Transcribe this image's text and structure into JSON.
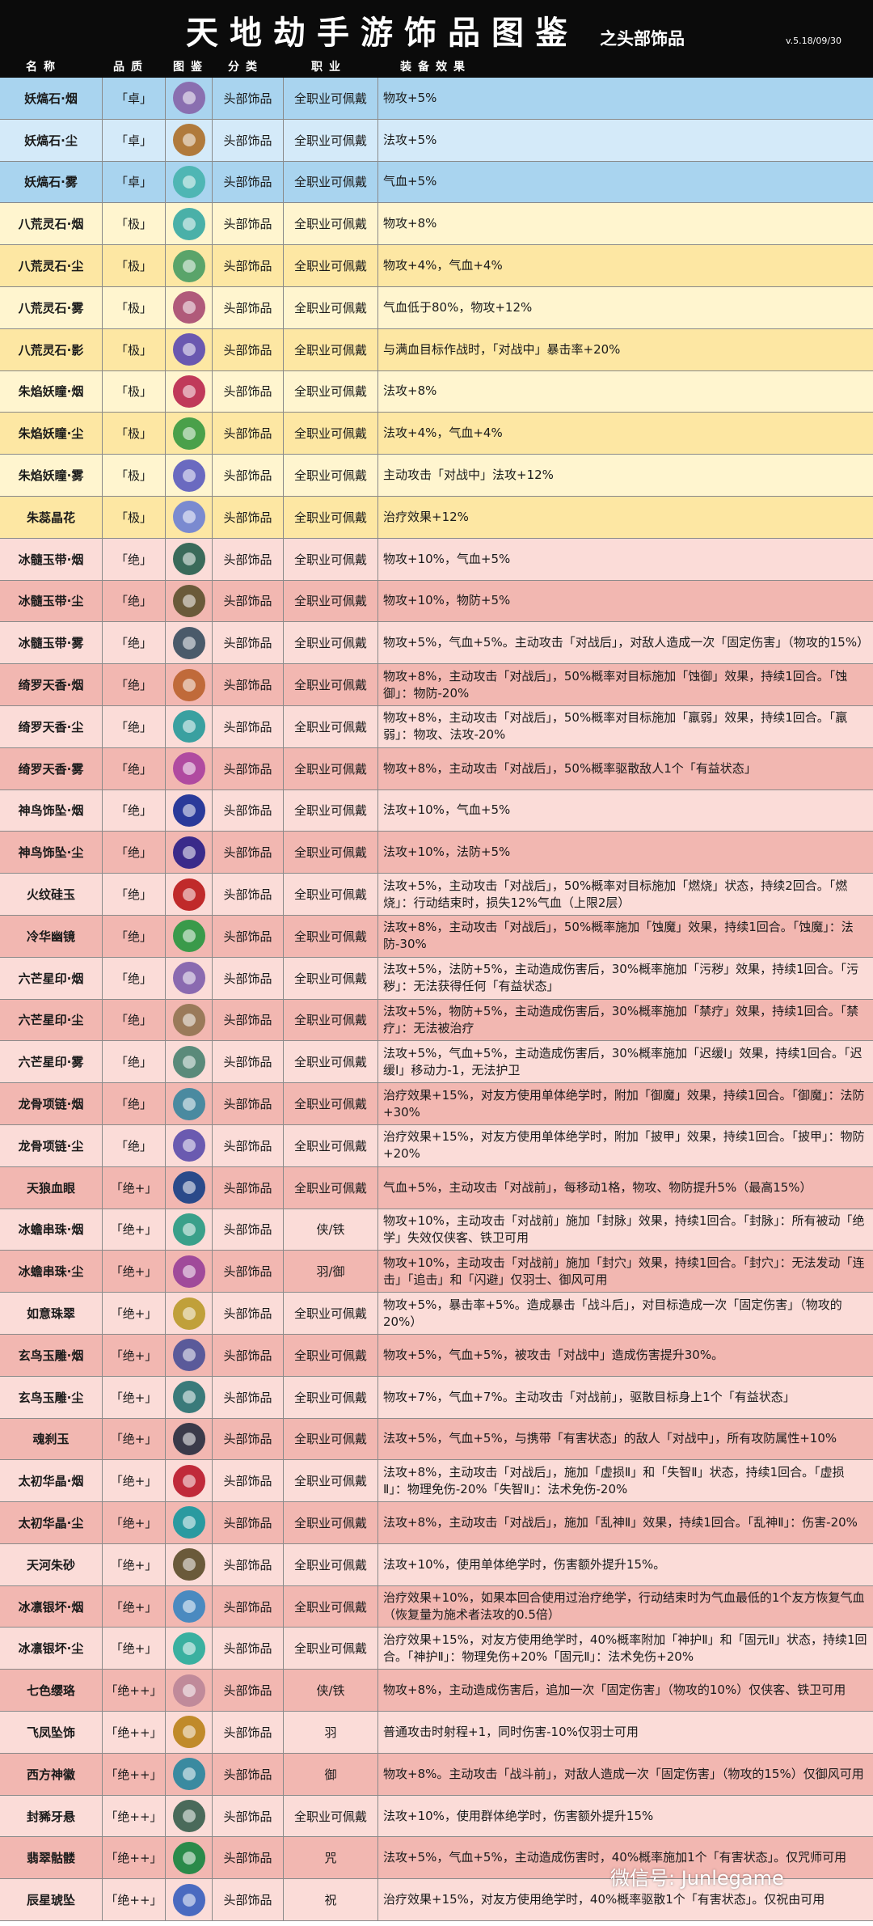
{
  "header": {
    "title": "天地劫手游饰品图鉴",
    "subtitle": "之头部饰品",
    "version": "v.5.18/09/30"
  },
  "columns": [
    "名称",
    "品质",
    "图鉴",
    "分类",
    "职业",
    "装备效果"
  ],
  "rows": [
    {
      "name": "妖熇石·烟",
      "quality": "「卓」",
      "icon": "pendant-icon",
      "icon_color": "#8a6fb0",
      "slot": "头部饰品",
      "job": "全职业可佩戴",
      "effect": "物攻+5%"
    },
    {
      "name": "妖熇石·尘",
      "quality": "「卓」",
      "icon": "pendant-icon",
      "icon_color": "#b07a3c",
      "slot": "头部饰品",
      "job": "全职业可佩戴",
      "effect": "法攻+5%"
    },
    {
      "name": "妖熇石·雾",
      "quality": "「卓」",
      "icon": "pendant-icon",
      "icon_color": "#4fb6b4",
      "slot": "头部饰品",
      "job": "全职业可佩戴",
      "effect": "气血+5%"
    },
    {
      "name": "八荒灵石·烟",
      "quality": "「极」",
      "icon": "crystal-icon",
      "icon_color": "#4ab0a8",
      "slot": "头部饰品",
      "job": "全职业可佩戴",
      "effect": "物攻+8%"
    },
    {
      "name": "八荒灵石·尘",
      "quality": "「极」",
      "icon": "crystal-icon",
      "icon_color": "#5aa46a",
      "slot": "头部饰品",
      "job": "全职业可佩戴",
      "effect": "物攻+4%，气血+4%"
    },
    {
      "name": "八荒灵石·雾",
      "quality": "「极」",
      "icon": "crystal-icon",
      "icon_color": "#b05a7a",
      "slot": "头部饰品",
      "job": "全职业可佩戴",
      "effect": "气血低于80%，物攻+12%"
    },
    {
      "name": "八荒灵石·影",
      "quality": "「极」",
      "icon": "crystal-icon",
      "icon_color": "#6a58b0",
      "slot": "头部饰品",
      "job": "全职业可佩戴",
      "effect": "与满血目标作战时，「对战中」暴击率+20%"
    },
    {
      "name": "朱焰妖瞳·烟",
      "quality": "「极」",
      "icon": "ring-icon",
      "icon_color": "#c03a5a",
      "slot": "头部饰品",
      "job": "全职业可佩戴",
      "effect": "法攻+8%"
    },
    {
      "name": "朱焰妖瞳·尘",
      "quality": "「极」",
      "icon": "ring-icon",
      "icon_color": "#4aa04a",
      "slot": "头部饰品",
      "job": "全职业可佩戴",
      "effect": "法攻+4%，气血+4%"
    },
    {
      "name": "朱焰妖瞳·雾",
      "quality": "「极」",
      "icon": "ring-icon",
      "icon_color": "#6a6ac0",
      "slot": "头部饰品",
      "job": "全职业可佩戴",
      "effect": "主动攻击「对战中」法攻+12%"
    },
    {
      "name": "朱蕊晶花",
      "quality": "「极」",
      "icon": "flower-icon",
      "icon_color": "#7a8ad0",
      "slot": "头部饰品",
      "job": "全职业可佩戴",
      "effect": "治疗效果+12%"
    },
    {
      "name": "冰髓玉带·烟",
      "quality": "「绝」",
      "icon": "belt-icon",
      "icon_color": "#3a6a5a",
      "slot": "头部饰品",
      "job": "全职业可佩戴",
      "effect": "物攻+10%，气血+5%"
    },
    {
      "name": "冰髓玉带·尘",
      "quality": "「绝」",
      "icon": "belt-icon",
      "icon_color": "#6a5a3a",
      "slot": "头部饰品",
      "job": "全职业可佩戴",
      "effect": "物攻+10%，物防+5%"
    },
    {
      "name": "冰髓玉带·雾",
      "quality": "「绝」",
      "icon": "belt-icon",
      "icon_color": "#4a5a6a",
      "slot": "头部饰品",
      "job": "全职业可佩戴",
      "effect": "物攻+5%，气血+5%。主动攻击「对战后」，对敌人造成一次「固定伤害」（物攻的15%）"
    },
    {
      "name": "绮罗天香·烟",
      "quality": "「绝」",
      "icon": "necklace-icon",
      "icon_color": "#c06a3a",
      "slot": "头部饰品",
      "job": "全职业可佩戴",
      "effect": "物攻+8%，主动攻击「对战后」，50%概率对目标施加「蚀御」效果，持续1回合。「蚀御」：物防-20%"
    },
    {
      "name": "绮罗天香·尘",
      "quality": "「绝」",
      "icon": "necklace-icon",
      "icon_color": "#3aa0a0",
      "slot": "头部饰品",
      "job": "全职业可佩戴",
      "effect": "物攻+8%，主动攻击「对战后」，50%概率对目标施加「羸弱」效果，持续1回合。「羸弱」：物攻、法攻-20%"
    },
    {
      "name": "绮罗天香·雾",
      "quality": "「绝」",
      "icon": "necklace-icon",
      "icon_color": "#b04aa0",
      "slot": "头部饰品",
      "job": "全职业可佩戴",
      "effect": "物攻+8%，主动攻击「对战后」，50%概率驱散敌人1个「有益状态」"
    },
    {
      "name": "神鸟饰坠·烟",
      "quality": "「绝」",
      "icon": "orb-icon",
      "icon_color": "#2a3a9a",
      "slot": "头部饰品",
      "job": "全职业可佩戴",
      "effect": "法攻+10%，气血+5%"
    },
    {
      "name": "神鸟饰坠·尘",
      "quality": "「绝」",
      "icon": "orb-icon",
      "icon_color": "#3a2a8a",
      "slot": "头部饰品",
      "job": "全职业可佩戴",
      "effect": "法攻+10%，法防+5%"
    },
    {
      "name": "火纹硅玉",
      "quality": "「绝」",
      "icon": "jade-icon",
      "icon_color": "#c02a2a",
      "slot": "头部饰品",
      "job": "全职业可佩戴",
      "effect": "法攻+5%，主动攻击「对战后」，50%概率对目标施加「燃烧」状态，持续2回合。「燃烧」：行动结束时，损失12%气血（上限2层）"
    },
    {
      "name": "冷华幽镜",
      "quality": "「绝」",
      "icon": "mirror-icon",
      "icon_color": "#3a9a4a",
      "slot": "头部饰品",
      "job": "全职业可佩戴",
      "effect": "法攻+8%，主动攻击「对战后」，50%概率施加「蚀魔」效果，持续1回合。「蚀魔」：法防-30%"
    },
    {
      "name": "六芒星印·烟",
      "quality": "「绝」",
      "icon": "seal-icon",
      "icon_color": "#8a6ab0",
      "slot": "头部饰品",
      "job": "全职业可佩戴",
      "effect": "法攻+5%，法防+5%，主动造成伤害后，30%概率施加「污秽」效果，持续1回合。「污秽」：无法获得任何「有益状态」"
    },
    {
      "name": "六芒星印·尘",
      "quality": "「绝」",
      "icon": "seal-icon",
      "icon_color": "#9a7a5a",
      "slot": "头部饰品",
      "job": "全职业可佩戴",
      "effect": "法攻+5%，物防+5%，主动造成伤害后，30%概率施加「禁疗」效果，持续1回合。「禁疗」：无法被治疗"
    },
    {
      "name": "六芒星印·雾",
      "quality": "「绝」",
      "icon": "seal-icon",
      "icon_color": "#5a8a7a",
      "slot": "头部饰品",
      "job": "全职业可佩戴",
      "effect": "法攻+5%，气血+5%，主动造成伤害后，30%概率施加「迟缓Ⅰ」效果，持续1回合。「迟缓Ⅰ」移动力-1，无法护卫"
    },
    {
      "name": "龙骨项链·烟",
      "quality": "「绝」",
      "icon": "bone-necklace-icon",
      "icon_color": "#4a8aa0",
      "slot": "头部饰品",
      "job": "全职业可佩戴",
      "effect": "治疗效果+15%，对友方使用单体绝学时，附加「御魔」效果，持续1回合。「御魔」：法防+30%"
    },
    {
      "name": "龙骨项链·尘",
      "quality": "「绝」",
      "icon": "bone-necklace-icon",
      "icon_color": "#6a5ab0",
      "slot": "头部饰品",
      "job": "全职业可佩戴",
      "effect": "治疗效果+15%，对友方使用单体绝学时，附加「披甲」效果，持续1回合。「披甲」：物防+20%"
    },
    {
      "name": "天狼血眼",
      "quality": "「绝+」",
      "icon": "eye-ring-icon",
      "icon_color": "#2a4a8a",
      "slot": "头部饰品",
      "job": "全职业可佩戴",
      "effect": "气血+5%，主动攻击「对战前」，每移动1格，物攻、物防提升5%（最高15%）"
    },
    {
      "name": "冰蟾串珠·烟",
      "quality": "「绝+」",
      "icon": "beads-icon",
      "icon_color": "#3aa08a",
      "slot": "头部饰品",
      "job": "侠/铁",
      "effect": "物攻+10%，主动攻击「对战前」施加「封脉」效果，持续1回合。「封脉」：所有被动「绝学」失效仅侠客、铁卫可用"
    },
    {
      "name": "冰蟾串珠·尘",
      "quality": "「绝+」",
      "icon": "beads-icon",
      "icon_color": "#a04a9a",
      "slot": "头部饰品",
      "job": "羽/御",
      "effect": "物攻+10%，主动攻击「对战前」施加「封穴」效果，持续1回合。「封穴」：无法发动「连击」「追击」和「闪避」仅羽士、御风可用"
    },
    {
      "name": "如意珠翠",
      "quality": "「绝+」",
      "icon": "gold-pendant-icon",
      "icon_color": "#c0a03a",
      "slot": "头部饰品",
      "job": "全职业可佩戴",
      "effect": "物攻+5%，暴击率+5%。造成暴击「战斗后」，对目标造成一次「固定伤害」（物攻的20%）"
    },
    {
      "name": "玄鸟玉雕·烟",
      "quality": "「绝+」",
      "icon": "bird-icon",
      "icon_color": "#5a5a9a",
      "slot": "头部饰品",
      "job": "全职业可佩戴",
      "effect": "物攻+5%，气血+5%，被攻击「对战中」造成伤害提升30%。"
    },
    {
      "name": "玄鸟玉雕·尘",
      "quality": "「绝+」",
      "icon": "bird-icon",
      "icon_color": "#3a7a7a",
      "slot": "头部饰品",
      "job": "全职业可佩戴",
      "effect": "物攻+7%，气血+7%。主动攻击「对战前」，驱散目标身上1个「有益状态」"
    },
    {
      "name": "魂刹玉",
      "quality": "「绝+」",
      "icon": "skull-jade-icon",
      "icon_color": "#3a3a4a",
      "slot": "头部饰品",
      "job": "全职业可佩戴",
      "effect": "法攻+5%，气血+5%，与携带「有害状态」的敌人「对战中」，所有攻防属性+10%"
    },
    {
      "name": "太初华晶·烟",
      "quality": "「绝+」",
      "icon": "bracelet-icon",
      "icon_color": "#c02a3a",
      "slot": "头部饰品",
      "job": "全职业可佩戴",
      "effect": "法攻+8%，主动攻击「对战后」，施加「虚损Ⅱ」和「失智Ⅱ」状态，持续1回合。「虚损Ⅱ」：物理免伤-20%「失智Ⅱ」：法术免伤-20%"
    },
    {
      "name": "太初华晶·尘",
      "quality": "「绝+」",
      "icon": "bracelet-icon",
      "icon_color": "#2a9aa0",
      "slot": "头部饰品",
      "job": "全职业可佩戴",
      "effect": "法攻+8%，主动攻击「对战后」，施加「乱神Ⅱ」效果，持续1回合。「乱神Ⅱ」：伤害-20%"
    },
    {
      "name": "天河朱砂",
      "quality": "「绝+」",
      "icon": "crown-icon",
      "icon_color": "#6a5a3a",
      "slot": "头部饰品",
      "job": "全职业可佩戴",
      "effect": "法攻+10%，使用单体绝学时，伤害额外提升15%。"
    },
    {
      "name": "冰凛银坏·烟",
      "quality": "「绝+」",
      "icon": "ice-crystal-icon",
      "icon_color": "#4a8ac0",
      "slot": "头部饰品",
      "job": "全职业可佩戴",
      "effect": "治疗效果+10%，如果本回合使用过治疗绝学，行动结束时为气血最低的1个友方恢复气血（恢复量为施术者法攻的0.5倍）"
    },
    {
      "name": "冰凛银坏·尘",
      "quality": "「绝+」",
      "icon": "ice-crystal-icon",
      "icon_color": "#3ab0a0",
      "slot": "头部饰品",
      "job": "全职业可佩戴",
      "effect": "治疗效果+15%，对友方使用绝学时，40%概率附加「神护Ⅱ」和「固元Ⅱ」状态，持续1回合。「神护Ⅱ」：物理免伤+20%「固元Ⅱ」：法术免伤+20%"
    },
    {
      "name": "七色缨珞",
      "quality": "「绝++」",
      "icon": "tassel-icon",
      "icon_color": "#c08a9a",
      "slot": "头部饰品",
      "job": "侠/铁",
      "effect": "物攻+8%，主动造成伤害后，追加一次「固定伤害」（物攻的10%）仅侠客、铁卫可用"
    },
    {
      "name": "飞凤坠饰",
      "quality": "「绝++」",
      "icon": "phoenix-icon",
      "icon_color": "#c08a2a",
      "slot": "头部饰品",
      "job": "羽",
      "effect": "普通攻击时射程+1，同时伤害-10%仅羽士可用"
    },
    {
      "name": "西方神徽",
      "quality": "「绝++」",
      "icon": "emblem-icon",
      "icon_color": "#3a8aa0",
      "slot": "头部饰品",
      "job": "御",
      "effect": "物攻+8%。主动攻击「战斗前」，对敌人造成一次「固定伤害」（物攻的15%）仅御风可用"
    },
    {
      "name": "封豨牙悬",
      "quality": "「绝++」",
      "icon": "fang-icon",
      "icon_color": "#4a6a5a",
      "slot": "头部饰品",
      "job": "全职业可佩戴",
      "effect": "法攻+10%，使用群体绝学时，伤害额外提升15%"
    },
    {
      "name": "翡翠骷髅",
      "quality": "「绝++」",
      "icon": "skull-icon",
      "icon_color": "#2a8a4a",
      "slot": "头部饰品",
      "job": "咒",
      "effect": "法攻+5%，气血+5%，主动造成伤害时，40%概率施加1个「有害状态」。仅咒师可用"
    },
    {
      "name": "辰星琥坠",
      "quality": "「绝++」",
      "icon": "star-pendant-icon",
      "icon_color": "#4a6ac0",
      "slot": "头部饰品",
      "job": "祝",
      "effect": "治疗效果+15%，对友方使用绝学时，40%概率驱散1个「有害状态」。仅祝由可用"
    }
  ],
  "watermark": "微信号: Junlegame",
  "colors": {
    "header_bg": "#0b0b0b",
    "blue": "#a9d4ef",
    "yellow": "#fde7a3",
    "red": "#f2b7b1"
  }
}
